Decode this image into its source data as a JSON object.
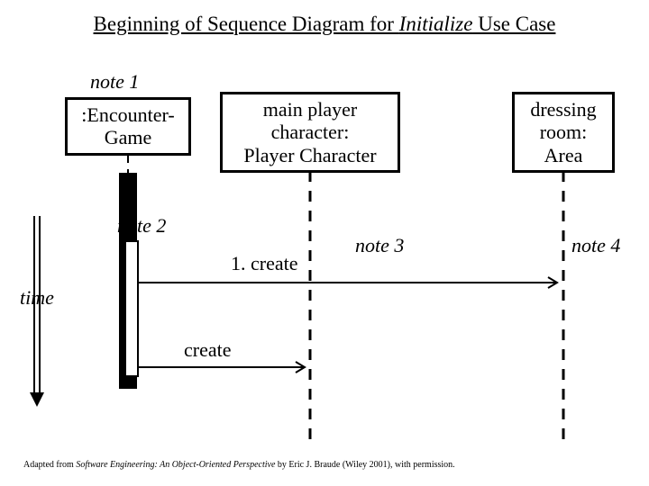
{
  "title": {
    "pre": "Beginning of Sequence Diagram for ",
    "italic": "Initialize",
    "post": " Use Case"
  },
  "boxes": {
    "encounter": ":Encounter-\nGame",
    "player": "main player\ncharacter:\nPlayer Character",
    "area": "dressing\nroom:\nArea"
  },
  "notes": {
    "n1": "note 1",
    "n2": "note 2",
    "n3": "note 3",
    "n4": "note 4"
  },
  "messages": {
    "m1": "1. create",
    "m2": "create"
  },
  "axis": {
    "time": "time"
  },
  "footer": {
    "pre": "Adapted from ",
    "ital": "Software Engineering: An Object-Oriented Perspective",
    "post": " by Eric J. Braude (Wiley 2001), with permission."
  }
}
